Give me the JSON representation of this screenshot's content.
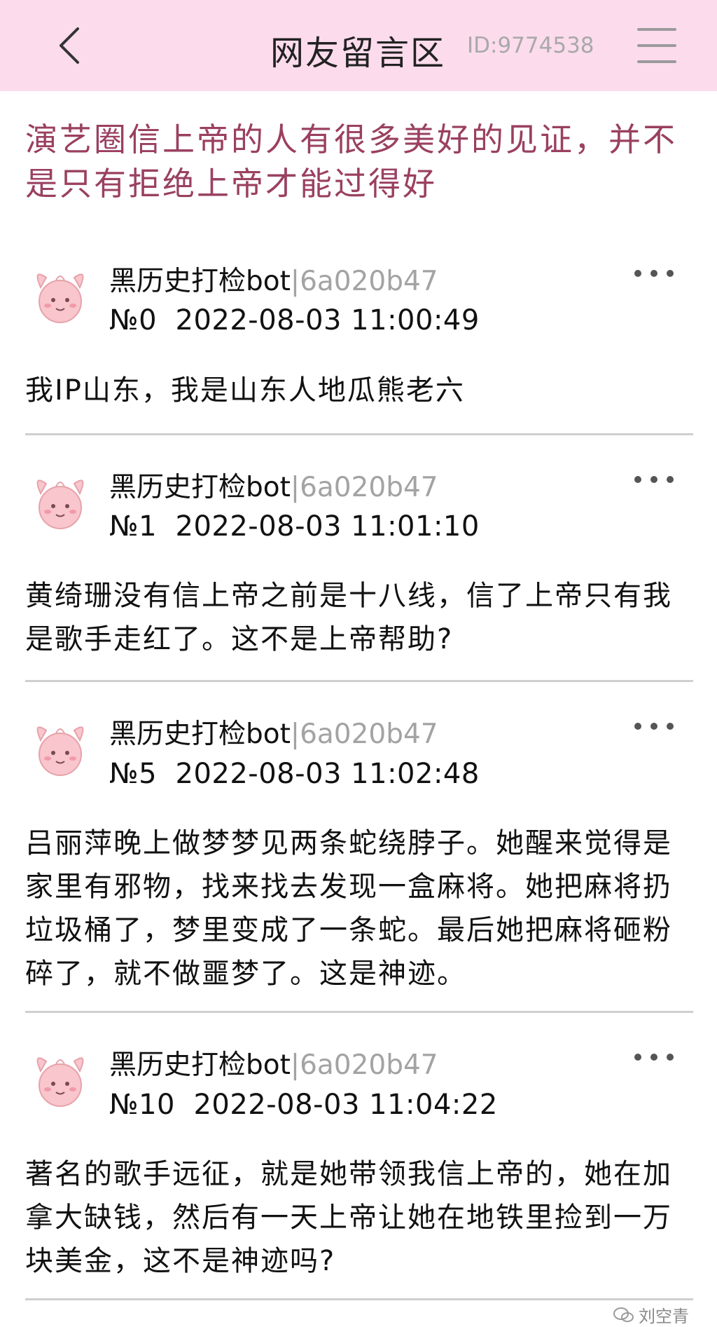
{
  "header": {
    "title": "网友留言区",
    "id_label": "ID:9774538"
  },
  "post": {
    "title": "演艺圈信上帝的人有很多美好的见证，并不是只有拒绝上帝才能过得好"
  },
  "comments": [
    {
      "user": "黑历史打检bot",
      "separator": "|",
      "hash": "6a020b47",
      "number": "№0",
      "timestamp": "2022-08-03 11:00:49",
      "text": "我IP山东，我是山东人地瓜熊老六"
    },
    {
      "user": "黑历史打检bot",
      "separator": "|",
      "hash": "6a020b47",
      "number": "№1",
      "timestamp": "2022-08-03 11:01:10",
      "text": "黄绮珊没有信上帝之前是十八线，信了上帝只有我是歌手走红了。这不是上帝帮助?"
    },
    {
      "user": "黑历史打检bot",
      "separator": "|",
      "hash": "6a020b47",
      "number": "№5",
      "timestamp": "2022-08-03 11:02:48",
      "text": "吕丽萍晚上做梦梦见两条蛇绕脖子。她醒来觉得是家里有邪物，找来找去发现一盒麻将。她把麻将扔垃圾桶了，梦里变成了一条蛇。最后她把麻将砸粉碎了，就不做噩梦了。这是神迹。"
    },
    {
      "user": "黑历史打检bot",
      "separator": "|",
      "hash": "6a020b47",
      "number": "№10",
      "timestamp": "2022-08-03 11:04:22",
      "text": "著名的歌手远征，就是她带领我信上帝的，她在加拿大缺钱，然后有一天上帝让她在地铁里捡到一万块美金，这不是神迹吗?"
    }
  ],
  "watermark": {
    "text": "刘空青",
    "icon": "wechat-icon"
  },
  "icons": {
    "back": "chevron-left-icon",
    "menu": "hamburger-menu-icon",
    "more": "more-dots-icon",
    "avatar": "clefairy-avatar"
  },
  "colors": {
    "header_bg": "#fcdcec",
    "title_accent": "#9a4060",
    "hash_gray": "#a3a3a3"
  }
}
